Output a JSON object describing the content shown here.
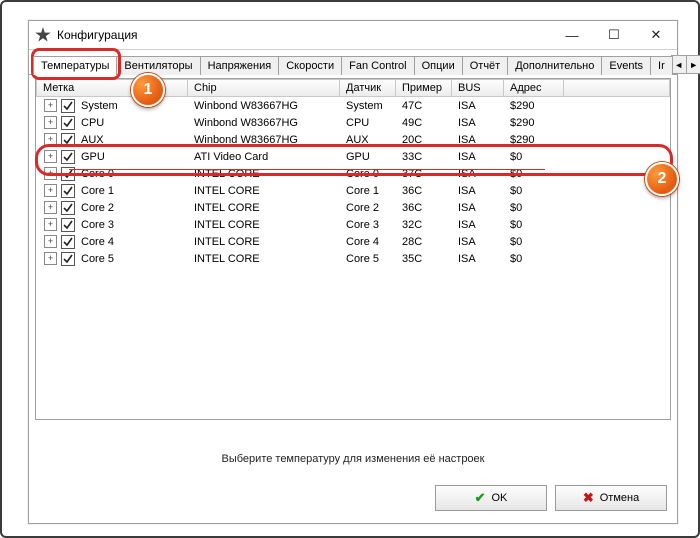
{
  "window": {
    "title": "Конфигурация"
  },
  "tabs": {
    "items": [
      "Температуры",
      "Вентиляторы",
      "Напряжения",
      "Скорости",
      "Fan Control",
      "Опции",
      "Отчёт",
      "Дополнительно",
      "Events",
      "Ir"
    ],
    "active": 0
  },
  "columns": {
    "label": "Метка",
    "chip": "Chip",
    "sensor": "Датчик",
    "sample": "Пример",
    "bus": "BUS",
    "addr": "Адрес"
  },
  "rows": [
    {
      "label": "System",
      "chip": "Winbond W83667HG",
      "sensor": "System",
      "sample": "47C",
      "bus": "ISA",
      "addr": "$290"
    },
    {
      "label": "CPU",
      "chip": "Winbond W83667HG",
      "sensor": "CPU",
      "sample": "49C",
      "bus": "ISA",
      "addr": "$290"
    },
    {
      "label": "AUX",
      "chip": "Winbond W83667HG",
      "sensor": "AUX",
      "sample": "20C",
      "bus": "ISA",
      "addr": "$290"
    },
    {
      "label": "GPU",
      "chip": "ATI Video Card",
      "sensor": "GPU",
      "sample": "33C",
      "bus": "ISA",
      "addr": "$0"
    },
    {
      "label": "Core 0",
      "chip": "INTEL CORE",
      "sensor": "Core 0",
      "sample": "37C",
      "bus": "ISA",
      "addr": "$0"
    },
    {
      "label": "Core 1",
      "chip": "INTEL CORE",
      "sensor": "Core 1",
      "sample": "36C",
      "bus": "ISA",
      "addr": "$0"
    },
    {
      "label": "Core 2",
      "chip": "INTEL CORE",
      "sensor": "Core 2",
      "sample": "36C",
      "bus": "ISA",
      "addr": "$0"
    },
    {
      "label": "Core 3",
      "chip": "INTEL CORE",
      "sensor": "Core 3",
      "sample": "32C",
      "bus": "ISA",
      "addr": "$0"
    },
    {
      "label": "Core 4",
      "chip": "INTEL CORE",
      "sensor": "Core 4",
      "sample": "28C",
      "bus": "ISA",
      "addr": "$0"
    },
    {
      "label": "Core 5",
      "chip": "INTEL CORE",
      "sensor": "Core 5",
      "sample": "35C",
      "bus": "ISA",
      "addr": "$0"
    }
  ],
  "hint": "Выберите температуру для изменения её настроек",
  "buttons": {
    "ok": "OK",
    "cancel": "Отмена"
  },
  "badges": {
    "one": "1",
    "two": "2"
  }
}
